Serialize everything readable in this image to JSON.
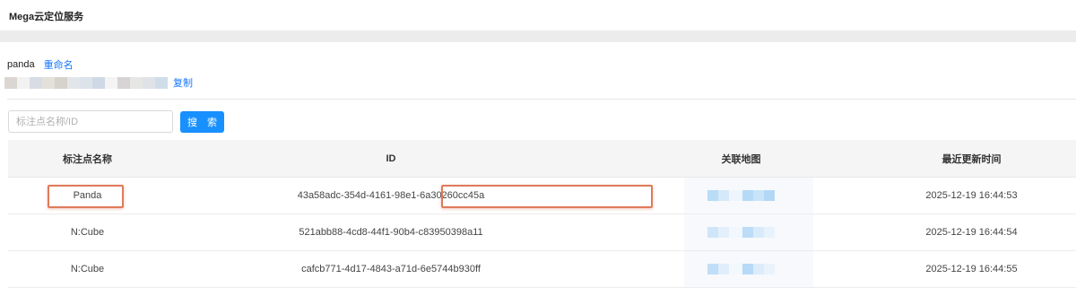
{
  "app": {
    "title": "Mega云定位服务"
  },
  "project": {
    "name": "panda",
    "rename_label": "重命名",
    "copy_label": "复制"
  },
  "search": {
    "placeholder": "标注点名称/ID",
    "button_label": "搜 索"
  },
  "table": {
    "columns": [
      "标注点名称",
      "ID",
      "关联地图",
      "最近更新时间"
    ],
    "rows": [
      {
        "name": "Panda",
        "id": "43a58adc-354d-4161-98e1-6a30260cc45a",
        "updated": "2025-12-19 16:44:53",
        "highlighted": true
      },
      {
        "name": "N:Cube",
        "id": "521abb88-4cd8-44f1-90b4-c83950398a11",
        "updated": "2025-12-19 16:44:54",
        "highlighted": false
      },
      {
        "name": "N:Cube",
        "id": "cafcb771-4d17-4843-a71d-6e5744b930ff",
        "updated": "2025-12-19 16:44:55",
        "highlighted": false
      }
    ]
  },
  "colors": {
    "accent": "#1890ff",
    "link": "#1677ff",
    "highlight": "#e07a5a",
    "header_bg": "#f5f5f5"
  }
}
